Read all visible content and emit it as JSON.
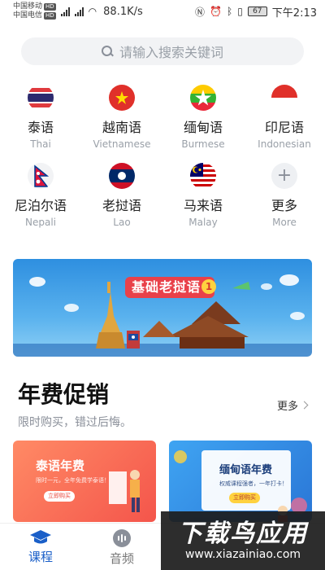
{
  "status_bar": {
    "carrier1": "中国移动",
    "carrier2": "中国电信",
    "hd": "HD",
    "net_speed": "88.1K/s",
    "battery": "67",
    "time": "下午2:13"
  },
  "search": {
    "placeholder": "请输入搜索关键词"
  },
  "languages": [
    {
      "name": "泰语",
      "en": "Thai"
    },
    {
      "name": "越南语",
      "en": "Vietnamese"
    },
    {
      "name": "缅甸语",
      "en": "Burmese"
    },
    {
      "name": "印尼语",
      "en": "Indonesian"
    },
    {
      "name": "尼泊尔语",
      "en": "Nepali"
    },
    {
      "name": "老挝语",
      "en": "Lao"
    },
    {
      "name": "马来语",
      "en": "Malay"
    },
    {
      "name": "更多",
      "en": "More"
    }
  ],
  "banner": {
    "title": "基础老挝语",
    "number": "1"
  },
  "promo": {
    "title": "年费促销",
    "subtitle": "限时购买，错过后悔。",
    "more": "更多",
    "cards": [
      {
        "title": "泰语年费",
        "desc": "限时一元，全年免费学泰语！",
        "button": "立即购买"
      },
      {
        "title": "缅甸语年费",
        "desc": "权威课程强者，一年打卡！",
        "button": "立即购买"
      }
    ]
  },
  "bottom_nav": [
    {
      "label": "课程",
      "icon": "graduation-cap-icon",
      "active": true
    },
    {
      "label": "音频",
      "icon": "audio-icon",
      "active": false
    }
  ],
  "watermark": {
    "title": "下载鸟应用",
    "url": "www.xiazainiao.com"
  },
  "colors": {
    "accent": "#1a5fc8",
    "banner": "#2e8fe0",
    "thai_card": "#f4554b",
    "burmese_card": "#2a76d6"
  }
}
